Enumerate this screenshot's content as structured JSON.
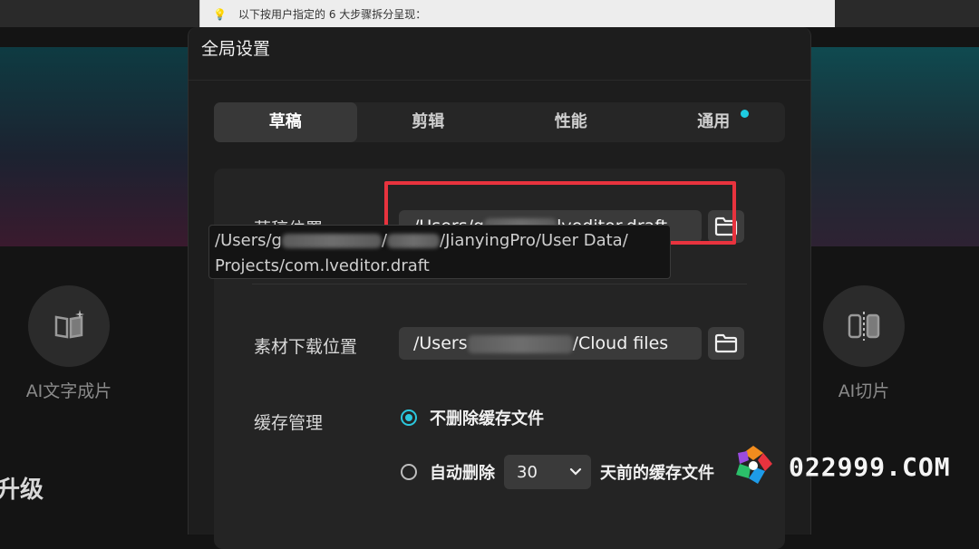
{
  "background": {
    "doc_text": "以下按用户指定的 6 大步骤拆分呈现：",
    "feature_left_label": "AI文字成片",
    "feature_right_label": "AI切片",
    "section_heading": "升级"
  },
  "dialog": {
    "title": "全局设置",
    "tabs": [
      {
        "label": "草稿",
        "active": true
      },
      {
        "label": "剪辑",
        "active": false
      },
      {
        "label": "性能",
        "active": false
      },
      {
        "label": "通用",
        "active": false,
        "has_dot": true
      }
    ],
    "draft_location": {
      "label": "草稿位置",
      "path_prefix": "/Users/g",
      "path_suffix": "lveditor.draft"
    },
    "tooltip": {
      "line1_prefix": "/Users/g",
      "line1_mid": "/",
      "line1_suffix": "/JianyingPro/User Data/",
      "line2": "Projects/com.lveditor.draft"
    },
    "download_location": {
      "label": "素材下载位置",
      "path_prefix": "/Users",
      "path_suffix": "/Cloud files"
    },
    "cache": {
      "label": "缓存管理",
      "option_keep": "不删除缓存文件",
      "option_auto_prefix": "自动删除",
      "days_value": "30",
      "option_auto_suffix": "天前的缓存文件",
      "selected": "keep"
    }
  },
  "watermark": {
    "text": "022999.COM"
  },
  "colors": {
    "accent": "#2bc7dd",
    "highlight_box": "#e8333e",
    "dialog_bg": "#1d1d1d"
  }
}
